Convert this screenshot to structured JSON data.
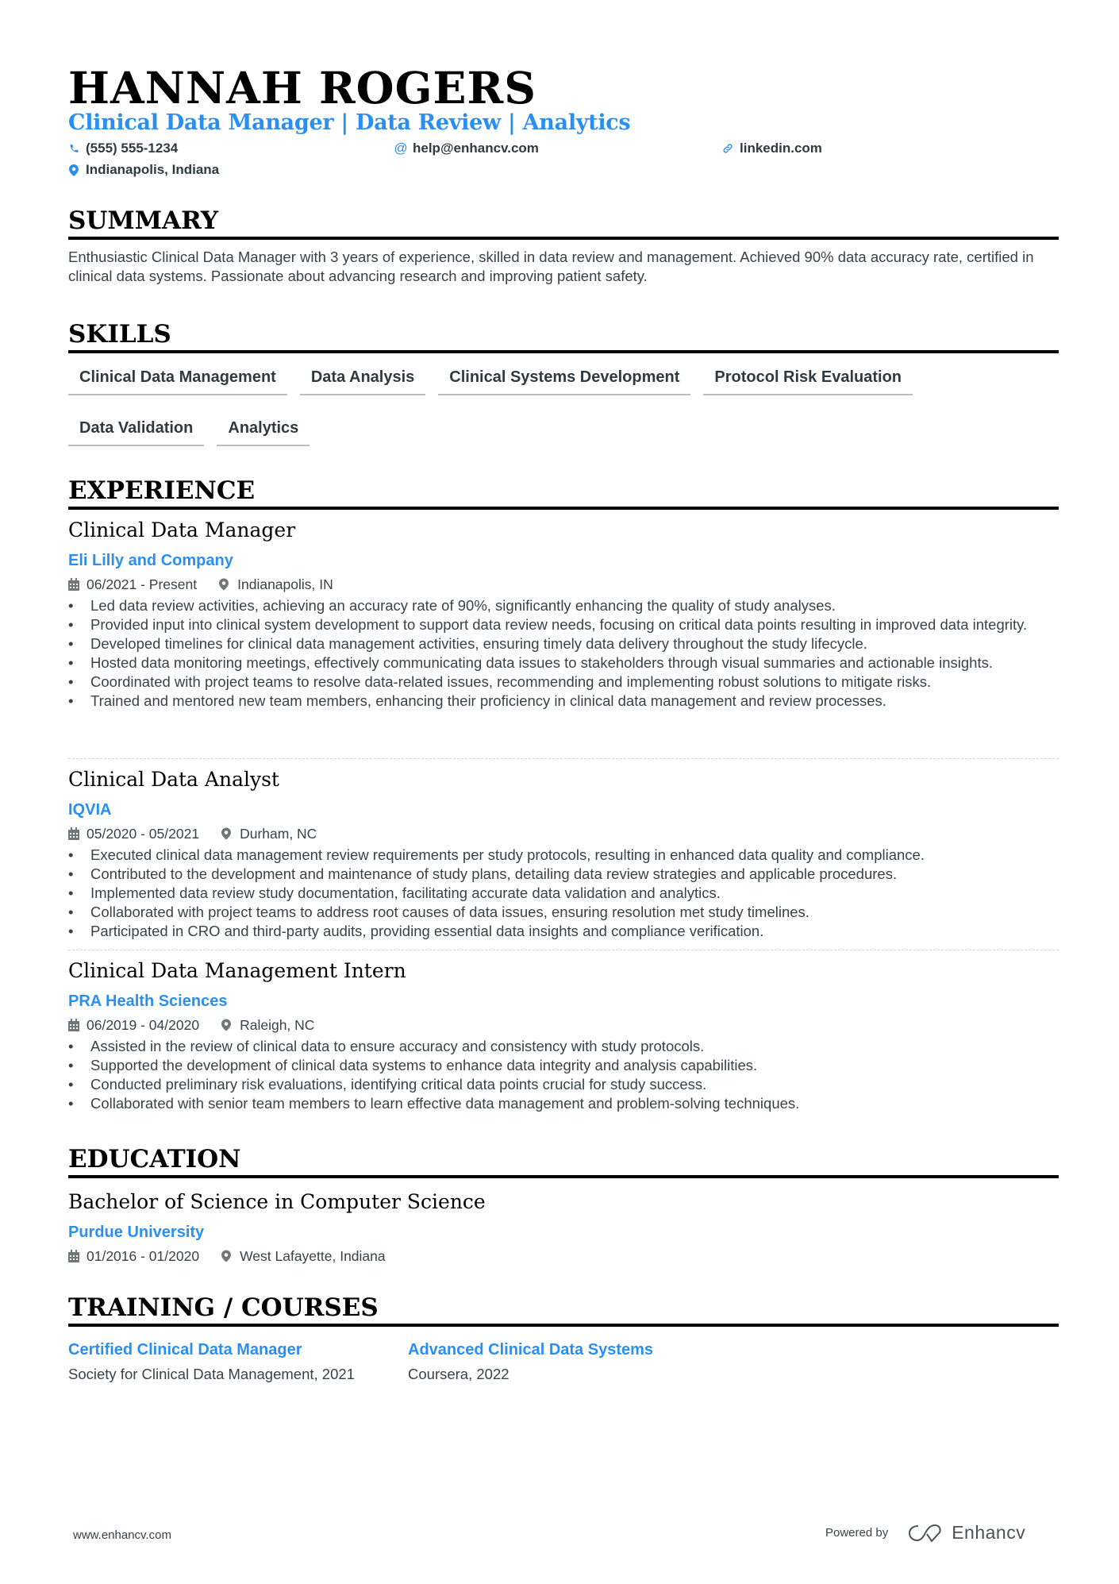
{
  "header": {
    "name": "HANNAH ROGERS",
    "title": "Clinical Data Manager | Data Review | Analytics",
    "contacts": {
      "phone": {
        "icon": "phone-icon",
        "value": "(555) 555-1234"
      },
      "email": {
        "icon": "at-icon",
        "value": "help@enhancv.com"
      },
      "linkedin": {
        "icon": "link-icon",
        "value": "linkedin.com"
      },
      "location": {
        "icon": "location-pin-icon",
        "value": "Indianapolis, Indiana"
      }
    }
  },
  "summary": {
    "heading": "SUMMARY",
    "text": "Enthusiastic Clinical Data Manager with 3 years of experience, skilled in data review and management. Achieved 90% data accuracy rate, certified in clinical data systems. Passionate about advancing research and improving patient safety."
  },
  "skills": {
    "heading": "SKILLS",
    "items": [
      "Clinical Data Management",
      "Data Analysis",
      "Clinical Systems Development",
      "Protocol Risk Evaluation",
      "Data Validation",
      "Analytics"
    ]
  },
  "experience": {
    "heading": "EXPERIENCE",
    "jobs": [
      {
        "title": "Clinical Data Manager",
        "company": "Eli Lilly and Company",
        "dates": "06/2021 - Present",
        "location": "Indianapolis, IN",
        "bullets": [
          "Led data review activities, achieving an accuracy rate of 90%, significantly enhancing the quality of study analyses.",
          "Provided input into clinical system development to support data review needs, focusing on critical data points resulting in improved data integrity.",
          "Developed timelines for clinical data management activities, ensuring timely data delivery throughout the study lifecycle.",
          "Hosted data monitoring meetings, effectively communicating data issues to stakeholders through visual summaries and actionable insights.",
          "Coordinated with project teams to resolve data-related issues, recommending and implementing robust solutions to mitigate risks.",
          "Trained and mentored new team members, enhancing their proficiency in clinical data management and review processes."
        ]
      },
      {
        "title": "Clinical Data Analyst",
        "company": "IQVIA",
        "dates": "05/2020 - 05/2021",
        "location": "Durham, NC",
        "bullets": [
          "Executed clinical data management review requirements per study protocols, resulting in enhanced data quality and compliance.",
          "Contributed to the development and maintenance of study plans, detailing data review strategies and applicable procedures.",
          "Implemented data review study documentation, facilitating accurate data validation and analytics.",
          "Collaborated with project teams to address root causes of data issues, ensuring resolution met study timelines.",
          "Participated in CRO and third-party audits, providing essential data insights and compliance verification."
        ]
      },
      {
        "title": "Clinical Data Management Intern",
        "company": "PRA Health Sciences",
        "dates": "06/2019 - 04/2020",
        "location": "Raleigh, NC",
        "bullets": [
          "Assisted in the review of clinical data to ensure accuracy and consistency with study protocols.",
          "Supported the development of clinical data systems to enhance data integrity and analysis capabilities.",
          "Conducted preliminary risk evaluations, identifying critical data points crucial for study success.",
          "Collaborated with senior team members to learn effective data management and problem-solving techniques."
        ]
      }
    ]
  },
  "education": {
    "heading": "EDUCATION",
    "degree": "Bachelor of Science in Computer Science",
    "school": "Purdue University",
    "dates": "01/2016 - 01/2020",
    "location": "West Lafayette, Indiana"
  },
  "training": {
    "heading": "TRAINING / COURSES",
    "courses": [
      {
        "title": "Certified Clinical Data Manager",
        "desc": "Society for Clinical Data Management, 2021"
      },
      {
        "title": "Advanced Clinical Data Systems",
        "desc": "Coursera, 2022"
      }
    ]
  },
  "footer": {
    "website": "www.enhancv.com",
    "powered_by": "Powered by",
    "brand": "Enhancv"
  },
  "colors": {
    "accent": "#2a8ff0",
    "text": "#384347",
    "heading": "#000000"
  }
}
